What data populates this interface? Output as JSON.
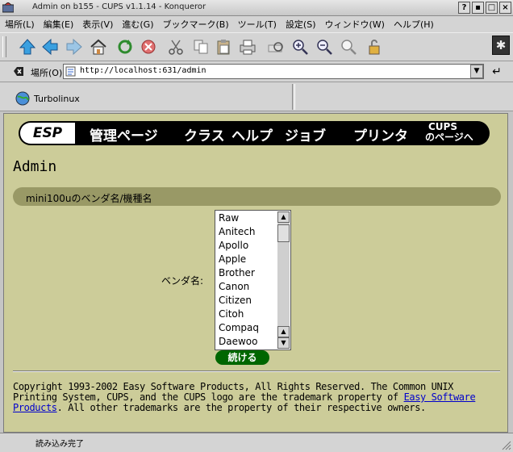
{
  "window": {
    "title": "Admin on b155 - CUPS v1.1.14 - Konqueror"
  },
  "menu": [
    "場所(L)",
    "編集(E)",
    "表示(V)",
    "進む(G)",
    "ブックマーク(B)",
    "ツール(T)",
    "設定(S)",
    "ウィンドウ(W)",
    "ヘルプ(H)"
  ],
  "location": {
    "label": "場所(O)",
    "url": "http://localhost:631/admin"
  },
  "bookmarks": {
    "item": "Turbolinux"
  },
  "banner": {
    "logo": "ESP",
    "nav": [
      "管理ページ",
      "クラス",
      "ヘルプ",
      "ジョブ",
      "プリンタ"
    ],
    "cups_line1": "CUPS",
    "cups_line2": "のページへ"
  },
  "page": {
    "title": "Admin",
    "section": "mini100uのベンダ名/機種名",
    "vendor_label": "ベンダ名:",
    "vendors": [
      "Raw",
      "Anitech",
      "Apollo",
      "Apple",
      "Brother",
      "Canon",
      "Citizen",
      "Citoh",
      "Compaq",
      "Daewoo"
    ],
    "continue_button": "続ける",
    "footer": {
      "text1": "Copyright 1993-2002 Easy Software Products, All Rights Reserved. The Common UNIX Printing System, CUPS, and the CUPS logo are the trademark property of ",
      "link": "Easy Software Products",
      "text2": ". All other trademarks are the property of their respective owners."
    }
  },
  "status": {
    "text": "読み込み完了"
  }
}
